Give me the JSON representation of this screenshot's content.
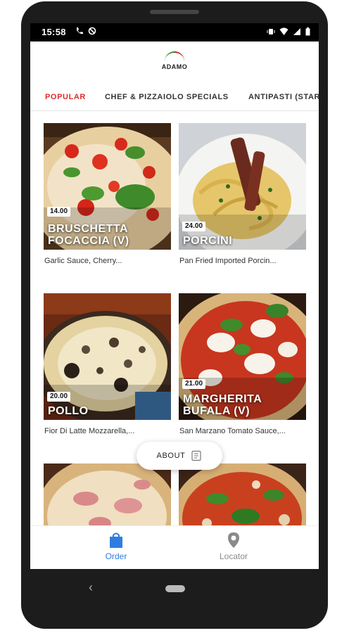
{
  "status_bar": {
    "time": "15:58"
  },
  "brand": {
    "logo_text": "ADAMO"
  },
  "tabs": [
    {
      "label": "POPULAR",
      "active": true
    },
    {
      "label": "CHEF & PIZZAIOLO SPECIALS",
      "active": false
    },
    {
      "label": "ANTIPASTI (STAR",
      "active": false
    }
  ],
  "menu_items": [
    {
      "name": "BRUSCHETTA FOCACCIA (V)",
      "price": "14.00",
      "description": "Garlic Sauce, Cherry..."
    },
    {
      "name": "PORCINI",
      "price": "24.00",
      "description": "Pan Fried Imported Porcin..."
    },
    {
      "name": "POLLO",
      "price": "20.00",
      "description": "Fior Di Latte Mozzarella,..."
    },
    {
      "name": "MARGHERITA BUFALA (V)",
      "price": "21.00",
      "description": "San Marzano Tomato Sauce,..."
    }
  ],
  "about_button": {
    "label": "ABOUT"
  },
  "bottom_nav": {
    "order_label": "Order",
    "locator_label": "Locator"
  },
  "colors": {
    "accent_red": "#d9302c",
    "active_blue": "#2f7de1",
    "inactive_gray": "#8a8a8a"
  }
}
